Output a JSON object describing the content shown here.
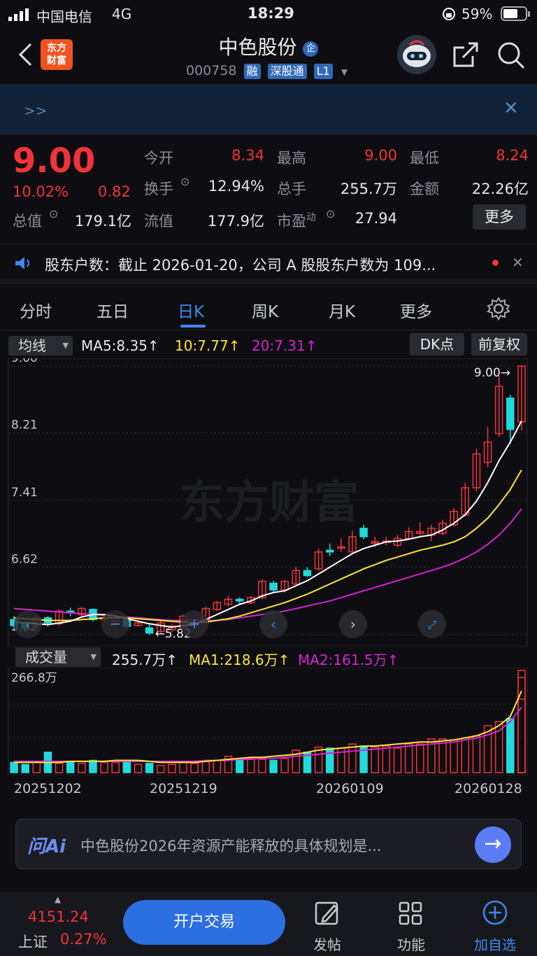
{
  "status_bar": {
    "carrier": "中国电信",
    "network": "4G",
    "time": "18:29",
    "battery": "59%"
  },
  "header": {
    "logo_line1": "东方",
    "logo_line2": "财富",
    "stock_name": "中色股份",
    "badge": "企",
    "code": "000758",
    "tags": [
      "融",
      "深股通",
      "L1"
    ]
  },
  "banner": {
    "arrows": ">>"
  },
  "quote": {
    "price": "9.00",
    "change_pct": "10.02%",
    "change_abs": "0.82",
    "today_open_label": "今开",
    "today_open": "8.34",
    "high_label": "最高",
    "high": "9.00",
    "low_label": "最低",
    "low": "8.24",
    "turnover_label": "换手",
    "turnover": "12.94%",
    "volume_label": "总手",
    "volume": "255.7万",
    "amount_label": "金额",
    "amount": "22.26亿",
    "total_mv_label": "总值",
    "total_mv": "179.1亿",
    "float_mv_label": "流值",
    "float_mv": "177.9亿",
    "pe_label": "市盈",
    "pe_sup": "动",
    "pe": "27.94",
    "more_label": "更多"
  },
  "news": {
    "text": "股东户数：截止 2026-01-20，公司 A 股股东户数为 109..."
  },
  "tabs": [
    "分时",
    "五日",
    "日K",
    "周K",
    "月K",
    "更多"
  ],
  "active_tab": "日K",
  "ma_row": {
    "selector": "均线",
    "ma5": "MA5:8.35↑",
    "ma10": "10:7.77↑",
    "ma20": "20:7.31↑",
    "dk_label": "DK点",
    "adjust_label": "前复权"
  },
  "price_axis": [
    "9.00",
    "8.21",
    "7.41",
    "6.62",
    "5.82"
  ],
  "marks": {
    "high": "9.00→",
    "low": "←5.82"
  },
  "watermark": "东方财富",
  "vol_row": {
    "selector": "成交量",
    "vol": "255.7万↑",
    "ma1": "MA1:218.6万↑",
    "ma2": "MA2:161.5万↑",
    "max": "266.8万"
  },
  "dates": [
    "20251202",
    "20251219",
    "20260109",
    "20260128"
  ],
  "colors": {
    "up": "#f0343a",
    "down": "#22d9dc",
    "ma5": "#ffffff",
    "ma10": "#ffe43a",
    "ma20": "#d823d2",
    "accent": "#3e88f0"
  },
  "ai": {
    "brand": "问Ai",
    "question": "中色股份2026年资源产能释放的具体规划是..."
  },
  "bottom": {
    "index_value": "4151.24",
    "index_name": "上证",
    "index_change": "0.27%",
    "trade_label": "开户交易",
    "post_label": "发帖",
    "func_label": "功能",
    "watch_label": "加自选"
  },
  "chart_data": {
    "type": "candlestick",
    "ylim": [
      5.82,
      9.0
    ],
    "candles": [
      {
        "o": 6.0,
        "c": 5.93,
        "h": 6.04,
        "l": 5.88
      },
      {
        "o": 5.95,
        "c": 5.9,
        "h": 5.97,
        "l": 5.85
      },
      {
        "o": 5.93,
        "c": 6.02,
        "h": 6.05,
        "l": 5.9
      },
      {
        "o": 6.02,
        "c": 5.96,
        "h": 6.04,
        "l": 5.92
      },
      {
        "o": 5.95,
        "c": 6.1,
        "h": 6.12,
        "l": 5.93
      },
      {
        "o": 6.1,
        "c": 6.08,
        "h": 6.14,
        "l": 6.04
      },
      {
        "o": 6.06,
        "c": 6.13,
        "h": 6.15,
        "l": 6.03
      },
      {
        "o": 6.12,
        "c": 6.0,
        "h": 6.13,
        "l": 5.98
      },
      {
        "o": 6.0,
        "c": 6.02,
        "h": 6.05,
        "l": 5.97
      },
      {
        "o": 5.98,
        "c": 6.02,
        "h": 6.04,
        "l": 5.96
      },
      {
        "o": 6.0,
        "c": 5.92,
        "h": 6.02,
        "l": 5.9
      },
      {
        "o": 5.93,
        "c": 5.96,
        "h": 5.99,
        "l": 5.92
      },
      {
        "o": 5.9,
        "c": 5.84,
        "h": 5.94,
        "l": 5.82
      },
      {
        "o": 5.86,
        "c": 5.96,
        "h": 5.98,
        "l": 5.84
      },
      {
        "o": 5.88,
        "c": 5.92,
        "h": 5.95,
        "l": 5.85
      },
      {
        "o": 5.9,
        "c": 6.04,
        "h": 6.06,
        "l": 5.88
      },
      {
        "o": 5.93,
        "c": 5.96,
        "h": 6.0,
        "l": 5.92
      },
      {
        "o": 6.0,
        "c": 6.13,
        "h": 6.15,
        "l": 5.99
      },
      {
        "o": 6.12,
        "c": 6.2,
        "h": 6.22,
        "l": 6.1
      },
      {
        "o": 6.18,
        "c": 6.24,
        "h": 6.28,
        "l": 6.16
      },
      {
        "o": 6.24,
        "c": 6.22,
        "h": 6.26,
        "l": 6.18
      },
      {
        "o": 6.2,
        "c": 6.26,
        "h": 6.28,
        "l": 6.18
      },
      {
        "o": 6.26,
        "c": 6.45,
        "h": 6.48,
        "l": 6.24
      },
      {
        "o": 6.43,
        "c": 6.35,
        "h": 6.46,
        "l": 6.33
      },
      {
        "o": 6.35,
        "c": 6.45,
        "h": 6.47,
        "l": 6.32
      },
      {
        "o": 6.42,
        "c": 6.58,
        "h": 6.62,
        "l": 6.4
      },
      {
        "o": 6.58,
        "c": 6.52,
        "h": 6.62,
        "l": 6.5
      },
      {
        "o": 6.6,
        "c": 6.8,
        "h": 6.84,
        "l": 6.58
      },
      {
        "o": 6.82,
        "c": 6.8,
        "h": 6.9,
        "l": 6.75
      },
      {
        "o": 6.85,
        "c": 6.86,
        "h": 6.96,
        "l": 6.8
      },
      {
        "o": 6.8,
        "c": 6.98,
        "h": 7.05,
        "l": 6.78
      },
      {
        "o": 7.08,
        "c": 6.98,
        "h": 7.12,
        "l": 6.95
      },
      {
        "o": 6.92,
        "c": 6.92,
        "h": 6.98,
        "l": 6.86
      },
      {
        "o": 6.92,
        "c": 6.93,
        "h": 6.98,
        "l": 6.88
      },
      {
        "o": 6.88,
        "c": 6.96,
        "h": 7.0,
        "l": 6.86
      },
      {
        "o": 6.96,
        "c": 7.04,
        "h": 7.09,
        "l": 6.95
      },
      {
        "o": 7.02,
        "c": 7.04,
        "h": 7.15,
        "l": 7.0
      },
      {
        "o": 7.0,
        "c": 7.08,
        "h": 7.12,
        "l": 6.93
      },
      {
        "o": 7.02,
        "c": 7.14,
        "h": 7.18,
        "l": 7.0
      },
      {
        "o": 7.12,
        "c": 7.28,
        "h": 7.32,
        "l": 7.1
      },
      {
        "o": 7.24,
        "c": 7.56,
        "h": 7.62,
        "l": 7.22
      },
      {
        "o": 7.56,
        "c": 7.96,
        "h": 8.02,
        "l": 7.52
      },
      {
        "o": 7.86,
        "c": 8.1,
        "h": 8.28,
        "l": 7.8
      },
      {
        "o": 8.2,
        "c": 8.76,
        "h": 8.88,
        "l": 8.16
      },
      {
        "o": 8.62,
        "c": 8.25,
        "h": 8.66,
        "l": 8.08
      },
      {
        "o": 8.34,
        "c": 9.0,
        "h": 9.0,
        "l": 8.24
      }
    ],
    "ma5": [
      5.97,
      5.96,
      5.95,
      5.94,
      5.96,
      5.98,
      6.03,
      6.06,
      6.06,
      6.04,
      6.01,
      5.98,
      5.95,
      5.93,
      5.91,
      5.93,
      5.94,
      6.0,
      6.06,
      6.12,
      6.18,
      6.22,
      6.28,
      6.32,
      6.34,
      6.4,
      6.46,
      6.54,
      6.62,
      6.7,
      6.78,
      6.84,
      6.88,
      6.92,
      6.93,
      6.95,
      6.98,
      7.0,
      7.06,
      7.14,
      7.24,
      7.4,
      7.62,
      7.88,
      8.1,
      8.35
    ],
    "ma10": [
      6.02,
      6.01,
      6.0,
      5.99,
      5.99,
      5.99,
      6.0,
      6.01,
      6.02,
      6.02,
      6.02,
      6.01,
      6.0,
      5.99,
      5.98,
      5.97,
      5.96,
      5.97,
      5.99,
      6.01,
      6.04,
      6.08,
      6.12,
      6.16,
      6.2,
      6.25,
      6.3,
      6.36,
      6.42,
      6.48,
      6.54,
      6.6,
      6.65,
      6.7,
      6.74,
      6.78,
      6.82,
      6.85,
      6.88,
      6.92,
      6.98,
      7.08,
      7.2,
      7.36,
      7.54,
      7.77
    ],
    "ma20": [
      6.13,
      6.12,
      6.11,
      6.1,
      6.09,
      6.08,
      6.07,
      6.06,
      6.05,
      6.04,
      6.03,
      6.02,
      6.01,
      6.0,
      5.99,
      5.99,
      5.99,
      5.99,
      5.99,
      6.0,
      6.02,
      6.04,
      6.06,
      6.08,
      6.1,
      6.13,
      6.16,
      6.19,
      6.22,
      6.26,
      6.3,
      6.34,
      6.38,
      6.42,
      6.46,
      6.5,
      6.54,
      6.58,
      6.62,
      6.67,
      6.73,
      6.8,
      6.89,
      7.0,
      7.14,
      7.31
    ],
    "volume": [
      10,
      8,
      11,
      20,
      9,
      11,
      9,
      12,
      10,
      10,
      11,
      8,
      9,
      7,
      8,
      10,
      9,
      11,
      12,
      16,
      12,
      14,
      13,
      12,
      14,
      22,
      20,
      25,
      24,
      24,
      28,
      26,
      25,
      26,
      24,
      28,
      28,
      33,
      33,
      32,
      34,
      36,
      46,
      50,
      53,
      72,
      100,
      93
    ],
    "vol_ma1": [
      10,
      10,
      10,
      10,
      10,
      11,
      11,
      11,
      11,
      12,
      12,
      12,
      11,
      10,
      10,
      10,
      10,
      11,
      12,
      13,
      14,
      15,
      15,
      16,
      17,
      18,
      20,
      22,
      23,
      24,
      25,
      26,
      26,
      27,
      28,
      29,
      30,
      30,
      31,
      32,
      34,
      36,
      40,
      46,
      55,
      80
    ],
    "vol_ma2": [
      11,
      11,
      11,
      11,
      11,
      11,
      11,
      11,
      11,
      11,
      11,
      11,
      11,
      11,
      11,
      11,
      11,
      12,
      12,
      12,
      13,
      13,
      14,
      14,
      15,
      16,
      17,
      18,
      19,
      20,
      21,
      22,
      23,
      24,
      25,
      26,
      27,
      28,
      29,
      30,
      32,
      34,
      37,
      41,
      50,
      64
    ]
  }
}
